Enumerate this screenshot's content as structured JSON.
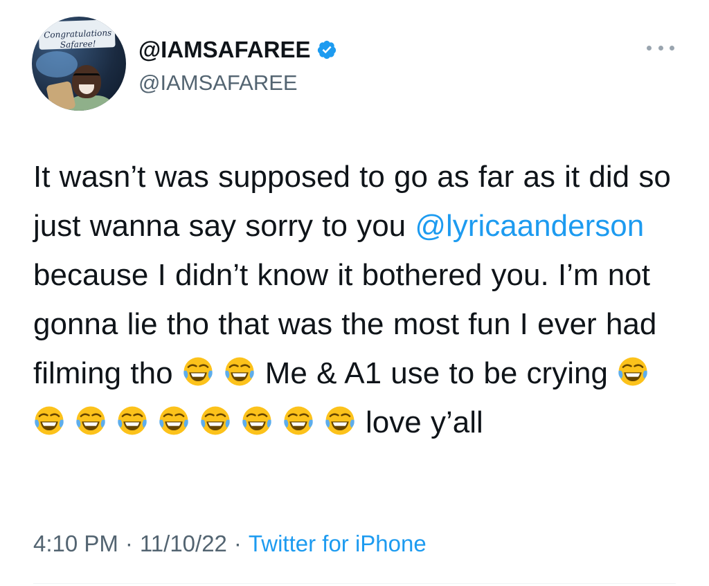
{
  "author": {
    "display_name": "@IAMSAFAREE",
    "handle": "@IAMSAFAREE",
    "verified": true,
    "avatar_caption_line1": "Congratulations",
    "avatar_caption_line2": "Safaree!"
  },
  "tweet": {
    "text_1": "It wasn’t was supposed to go as far as it did so just wanna say sorry to you ",
    "mention": "@lyricaanderson",
    "text_2": " because I didn’t know it bothered you. I’m not gonna lie tho that was the most fun I ever had filming tho ",
    "text_3": "Me & A1 use to be crying ",
    "text_4": "love y’all",
    "emoji_name": "face-with-tears-of-joy-icon",
    "emoji_count_group1": 2,
    "emoji_count_group2": 1,
    "emoji_count_group3": 8
  },
  "meta": {
    "time": "4:10 PM",
    "date": "11/10/22",
    "separator": "·",
    "source": "Twitter for iPhone"
  },
  "colors": {
    "accent": "#1d9bf0",
    "secondary_text": "#536471",
    "primary_text": "#0f1419"
  }
}
